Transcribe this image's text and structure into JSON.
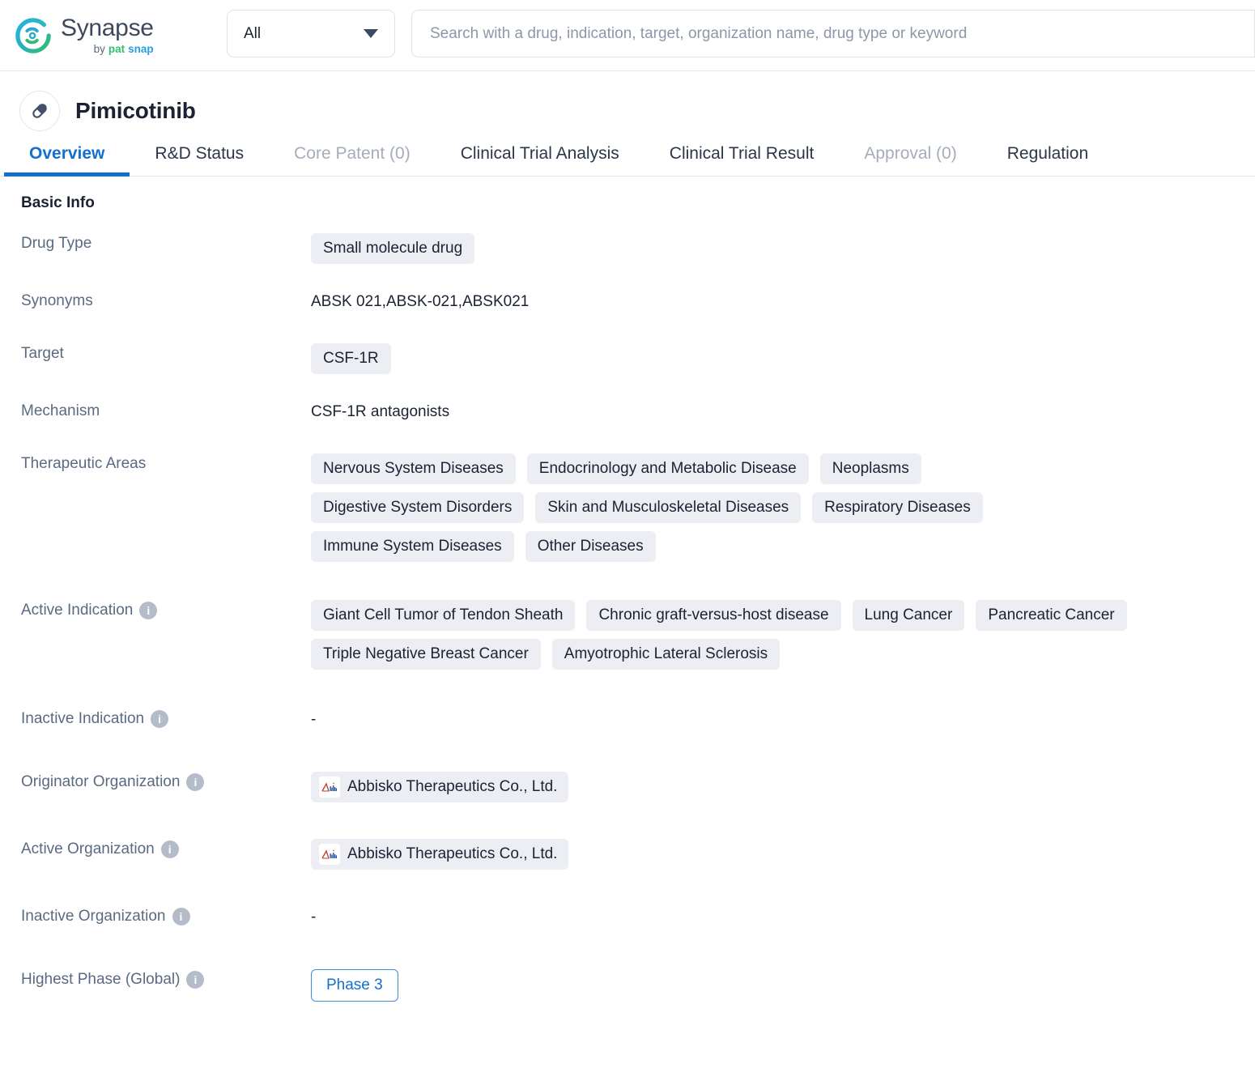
{
  "header": {
    "brand": {
      "name": "Synapse",
      "by": "by",
      "pat": "pat",
      "snap": "snap"
    },
    "scope_select": {
      "value": "All",
      "icon": "chevron-down-icon"
    },
    "search": {
      "value": "",
      "placeholder": "Search with a drug, indication, target, organization name, drug type or keyword"
    }
  },
  "page": {
    "title": "Pimicotinib",
    "avatar_icon": "capsule-icon"
  },
  "tabs": [
    {
      "label": "Overview",
      "state": "active"
    },
    {
      "label": "R&D Status",
      "state": "normal"
    },
    {
      "label": "Core Patent (0)",
      "state": "muted"
    },
    {
      "label": "Clinical Trial Analysis",
      "state": "normal"
    },
    {
      "label": "Clinical Trial Result",
      "state": "normal"
    },
    {
      "label": "Approval (0)",
      "state": "muted"
    },
    {
      "label": "Regulation",
      "state": "normal"
    }
  ],
  "basic_info": {
    "section_title": "Basic Info",
    "drug_type": {
      "label": "Drug Type",
      "tags": [
        "Small molecule drug"
      ]
    },
    "synonyms": {
      "label": "Synonyms",
      "value": "ABSK 021,ABSK-021,ABSK021"
    },
    "target": {
      "label": "Target",
      "tags": [
        "CSF-1R"
      ]
    },
    "mechanism": {
      "label": "Mechanism",
      "value": "CSF-1R antagonists"
    },
    "therapeutic_areas": {
      "label": "Therapeutic Areas",
      "tags": [
        "Nervous System Diseases",
        "Endocrinology and Metabolic Disease",
        "Neoplasms",
        "Digestive System Disorders",
        "Skin and Musculoskeletal Diseases",
        "Respiratory Diseases",
        "Immune System Diseases",
        "Other Diseases"
      ]
    },
    "active_indication": {
      "label": "Active Indication",
      "info": "i",
      "tags": [
        "Giant Cell Tumor of Tendon Sheath",
        "Chronic graft-versus-host disease",
        "Lung Cancer",
        "Pancreatic Cancer",
        "Triple Negative Breast Cancer",
        "Amyotrophic Lateral Sclerosis"
      ]
    },
    "inactive_indication": {
      "label": "Inactive Indication",
      "info": "i",
      "value": "-"
    },
    "originator_organization": {
      "label": "Originator Organization",
      "info": "i",
      "orgs": [
        {
          "name": "Abbisko Therapeutics Co., Ltd.",
          "logo": "abbisko-logo-icon"
        }
      ]
    },
    "active_organization": {
      "label": "Active Organization",
      "info": "i",
      "orgs": [
        {
          "name": "Abbisko Therapeutics Co., Ltd.",
          "logo": "abbisko-logo-icon"
        }
      ]
    },
    "inactive_organization": {
      "label": "Inactive Organization",
      "info": "i",
      "value": "-"
    },
    "highest_phase": {
      "label": "Highest Phase (Global)",
      "info": "i",
      "badge": "Phase 3"
    }
  },
  "colors": {
    "accent": "#1470cf",
    "tag_bg": "#eceef3",
    "label": "#5a6a82",
    "muted": "#a5adbb"
  }
}
